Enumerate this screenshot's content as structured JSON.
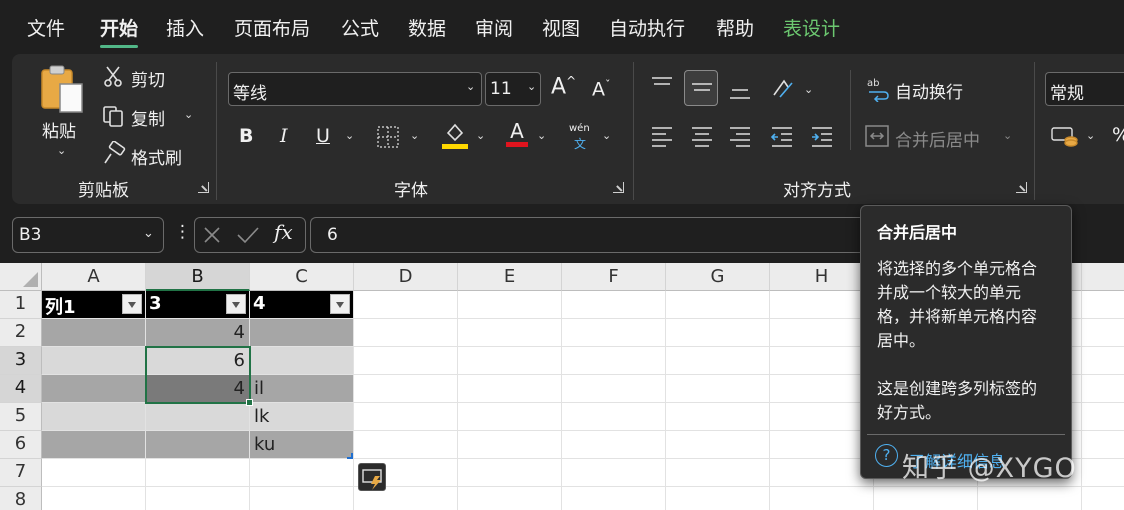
{
  "tabs": [
    "文件",
    "开始",
    "插入",
    "页面布局",
    "公式",
    "数据",
    "审阅",
    "视图",
    "自动执行",
    "帮助",
    "表设计"
  ],
  "clipboard": {
    "paste": "粘贴",
    "cut": "剪切",
    "copy": "复制",
    "format_painter": "格式刷",
    "group": "剪贴板"
  },
  "font": {
    "name": "等线",
    "size": "11",
    "bold": "B",
    "italic": "I",
    "underline": "U",
    "fill_letter": "A",
    "font_color_letter": "A",
    "phonetic": "wén",
    "phonetic_base": "文",
    "group": "字体"
  },
  "alignment": {
    "wrap_text": "自动换行",
    "merge_center": "合并后居中",
    "group": "对齐方式"
  },
  "number": {
    "format": "常规"
  },
  "formula_bar": {
    "name_box": "B3",
    "fx": "fx",
    "value": "6"
  },
  "columns": [
    "A",
    "B",
    "C",
    "D",
    "E",
    "F",
    "G",
    "H"
  ],
  "rows": [
    "1",
    "2",
    "3",
    "4",
    "5",
    "6",
    "7",
    "8"
  ],
  "table": {
    "headers": [
      "列1",
      "3",
      "4"
    ],
    "cells": {
      "B2": "4",
      "B3": "6",
      "B4": "4",
      "C4": "il",
      "C5": "lk",
      "C6": "ku"
    }
  },
  "tooltip": {
    "title": "合并后居中",
    "body": "将选择的多个单元格合\n并成一个较大的单元\n格，并将新单元格内容\n居中。\n\n这是创建跨多列标签的\n好方式。",
    "link": "了解详细信息"
  },
  "watermark": "知乎 @XYGO",
  "colors": {
    "accent_tab": "#52b788",
    "table_design_tab": "#6cc870",
    "selection": "#217346",
    "fill_yellow": "#ffd800",
    "font_red": "#e0141e",
    "link": "#4fb0f0"
  }
}
